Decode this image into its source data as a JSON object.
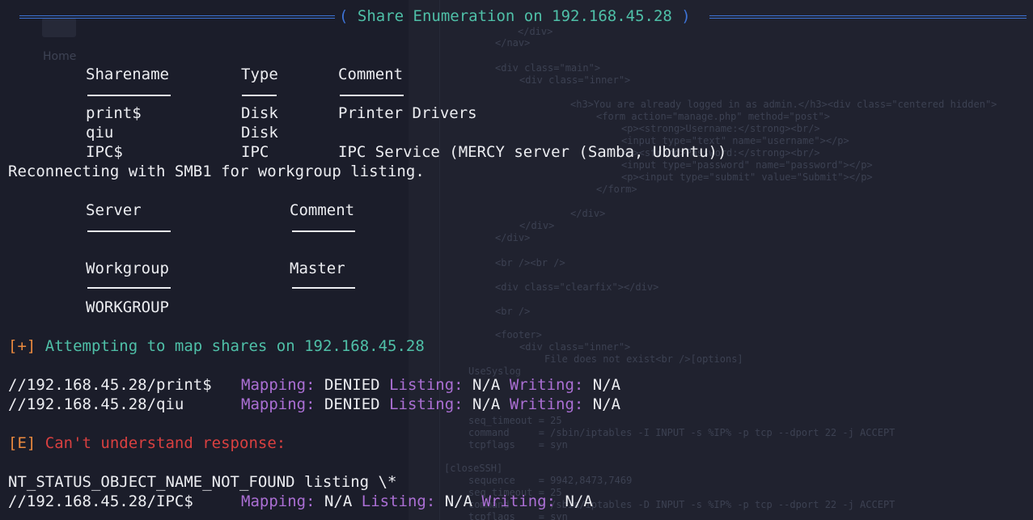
{
  "title": {
    "text": "Share Enumeration on 192.168.45.28",
    "open": "(",
    "close": ")"
  },
  "shares": {
    "headers": [
      "Sharename",
      "Type",
      "Comment"
    ],
    "rows": [
      {
        "name": "print$",
        "type": "Disk",
        "comment": "Printer Drivers"
      },
      {
        "name": "qiu",
        "type": "Disk",
        "comment": ""
      },
      {
        "name": "IPC$",
        "type": "IPC",
        "comment": "IPC Service (MERCY server (Samba, Ubuntu))"
      }
    ]
  },
  "reconnect_message": "Reconnecting with SMB1 for workgroup listing.",
  "servers": {
    "headers": [
      "Server",
      "Comment"
    ]
  },
  "workgroups": {
    "headers": [
      "Workgroup",
      "Master"
    ],
    "rows": [
      {
        "workgroup": "WORKGROUP",
        "master": ""
      }
    ]
  },
  "attempt": {
    "prefix": "[+]",
    "text": "Attempting to map shares on 192.168.45.28"
  },
  "mapping_labels": {
    "mapping": "Mapping:",
    "listing": "Listing:",
    "writing": "Writing:"
  },
  "mappings": [
    {
      "path": "//192.168.45.28/print$",
      "mapping": "DENIED",
      "listing": "N/A",
      "writing": "N/A"
    },
    {
      "path": "//192.168.45.28/qiu",
      "mapping": "DENIED",
      "listing": "N/A",
      "writing": "N/A"
    }
  ],
  "error": {
    "prefix": "[E]",
    "text": "Can't understand response:"
  },
  "nt_status": "NT_STATUS_OBJECT_NAME_NOT_FOUND listing \\*",
  "ipc_mapping": {
    "path": "//192.168.45.28/IPC$",
    "mapping": "N/A",
    "listing": "N/A",
    "writing": "N/A"
  },
  "colors": {
    "background": "#1b1d2a",
    "text": "#ecedf1",
    "title_rule": "#3d73d6",
    "teal": "#4fc0a8",
    "orange": "#ec8a3e",
    "purple": "#ab6fd4",
    "red": "#d94040"
  },
  "background_ghost": {
    "home_label": "Home",
    "code_lines": [
      "</div>",
      "</nav>",
      "<div class=\"main\">",
      "<div class=\"inner\">",
      "<h3>You are already logged in as admin.</h3><div class=\"centered hidden\">",
      "<form action=\"manage.php\" method=\"post\">",
      "<p><strong>Username:</strong><br/>",
      "<input type=\"text\" name=\"username\"></p>",
      "<p><strong>Password:</strong><br/>",
      "<input type=\"password\" name=\"password\"></p>",
      "<p><input type=\"submit\" value=\"Submit\"></p>",
      "</form>",
      "</div>",
      "</div>",
      "</div>",
      "<br /><br />",
      "<div class=\"clearfix\"></div>",
      "<br />",
      "<footer>",
      "<div class=\"inner\">",
      "File does not exist<br />[options]",
      "UseSyslog",
      "seq_timeout = 25",
      "command     = /sbin/iptables -I INPUT -s %IP% -p tcp --dport 22 -j ACCEPT",
      "tcpflags    = syn",
      "[closeSSH]",
      "sequence    = 9942,8473,7469",
      "seq_timeout = 25",
      "command     = /sbin/iptables -D INPUT -s %IP% -p tcp --dport 22 -j ACCEPT",
      "tcpflags    = syn"
    ]
  }
}
